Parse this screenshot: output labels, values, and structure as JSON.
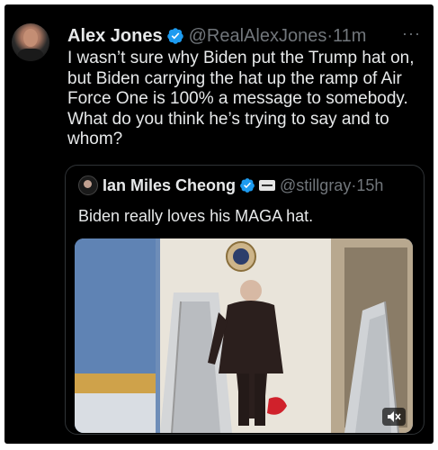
{
  "tweet": {
    "author_name": "Alex Jones",
    "author_handle": "@RealAlexJones",
    "time": "11m",
    "more_label": "···",
    "text": "I wasn’t sure why Biden put the Trump hat on, but Biden carrying the hat up the ramp of Air Force One is 100% a message to somebody. What do you think he’s trying to say and to whom?"
  },
  "quote": {
    "author_name": "Ian Miles Cheong",
    "author_handle": "@stillgray",
    "time": "15h",
    "text": "Biden really loves his MAGA hat.",
    "media": {
      "type": "video",
      "mute_icon": "volume-mute-icon"
    }
  },
  "colors": {
    "background": "#000000",
    "text": "#e7e9ea",
    "secondary_text": "#71767b",
    "verified_badge": "#1d9bf0",
    "border": "#2f3336"
  }
}
